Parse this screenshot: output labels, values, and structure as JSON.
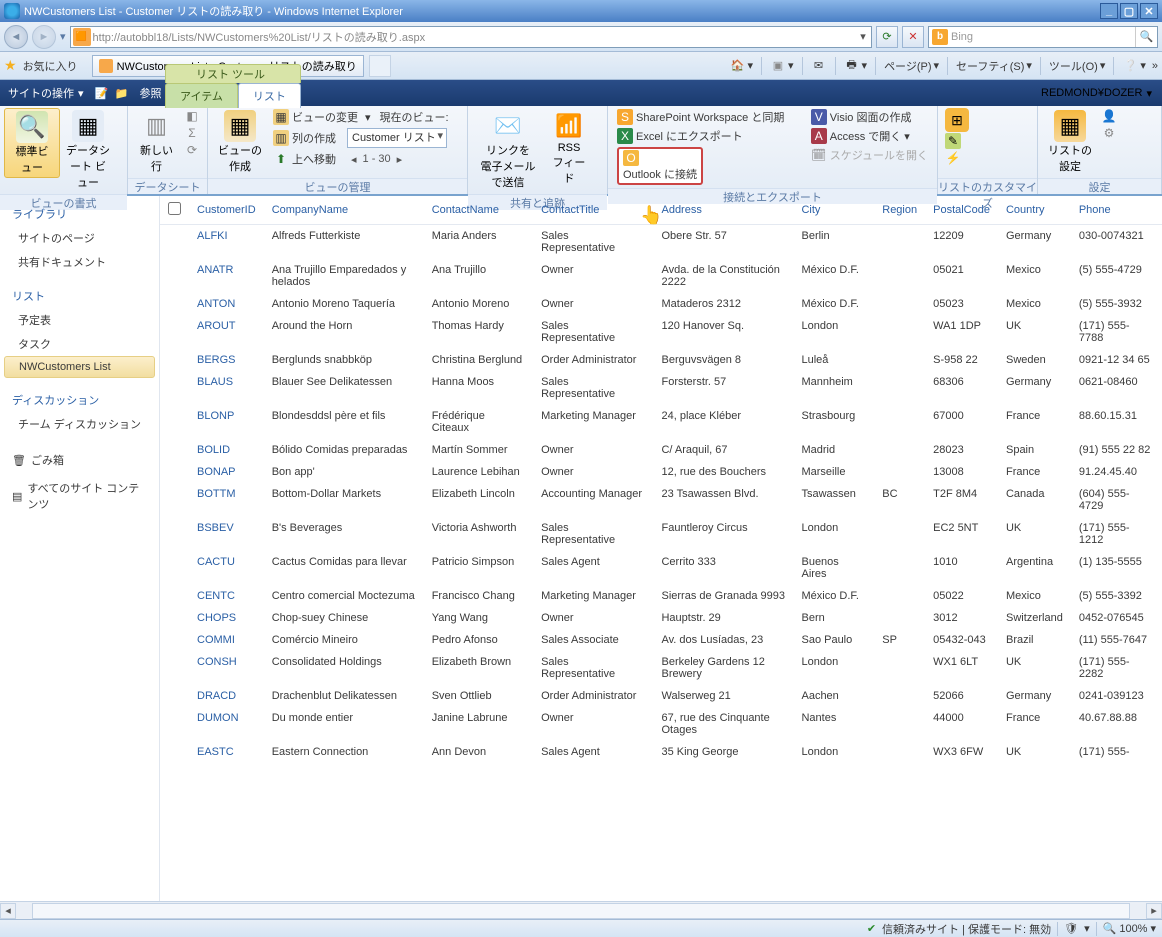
{
  "window": {
    "title": "NWCustomers List - Customer リストの読み取り - Windows Internet Explorer",
    "min": "_",
    "max": "▢",
    "close": "✕"
  },
  "nav": {
    "back": "◄",
    "forward": "►",
    "url": "http://autobbl18/Lists/NWCustomers%20List/リストの読み取り.aspx",
    "refresh": "⟳",
    "stop": "✕",
    "search_engine": "Bing",
    "bing_b": "b"
  },
  "favbar": {
    "favorites": "お気に入り",
    "tab_title": "NWCustomers List - Customer リストの読み取り",
    "page": "ページ(P)",
    "safety": "セーフティ(S)",
    "tools": "ツール(O)"
  },
  "sp": {
    "user": "REDMOND¥DOZER",
    "site_actions": "サイトの操作",
    "browse": "参照",
    "ctx_label": "リスト ツール",
    "tab_item": "アイテム",
    "tab_list": "リスト"
  },
  "ribbon": {
    "g_view_format": "ビューの書式",
    "standard_view": "標準ビュー",
    "datasheet_view": "データシート ビュー",
    "new_row": "新しい行",
    "g_datasheet": "データシート",
    "g_manage_views": "ビューの管理",
    "create_view": "ビューの作成",
    "modify_view": "ビューの変更",
    "current_view": "現在のビュー:",
    "create_column": "列の作成",
    "view_name": "Customer リスト",
    "navigate_up": "上へ移動",
    "paging": "1 - 30",
    "g_share": "共有と追跡",
    "email_link": "リンクを\n電子メールで送信",
    "rss": "RSS\nフィード",
    "g_connect": "接続とエクスポート",
    "sync_sp": "SharePoint Workspace と同期",
    "export_excel": "Excel にエクスポート",
    "outlook": "Outlook に接続",
    "visio": "Visio 図面の作成",
    "access": "Access で開く",
    "schedule": "スケジュールを開く",
    "g_customize": "リストのカスタマイズ",
    "g_settings": "設定",
    "list_settings": "リストの\n設定"
  },
  "ql": {
    "library": "ライブラリ",
    "site_pages": "サイトのページ",
    "shared_docs": "共有ドキュメント",
    "lists": "リスト",
    "calendar": "予定表",
    "tasks": "タスク",
    "nwcustomers": "NWCustomers List",
    "discussion": "ディスカッション",
    "team_disc": "チーム ディスカッション",
    "recycle": "ごみ箱",
    "all_content": "すべてのサイト コンテンツ"
  },
  "cols": {
    "CustomerID": "CustomerID",
    "CompanyName": "CompanyName",
    "ContactName": "ContactName",
    "ContactTitle": "ContactTitle",
    "Address": "Address",
    "City": "City",
    "Region": "Region",
    "PostalCode": "PostalCode",
    "Country": "Country",
    "Phone": "Phone"
  },
  "rows": [
    {
      "id": "ALFKI",
      "co": "Alfreds Futterkiste",
      "cn": "Maria Anders",
      "ct": "Sales Representative",
      "ad": "Obere Str. 57",
      "ci": "Berlin",
      "rg": "",
      "pc": "12209",
      "cy": "Germany",
      "ph": "030-0074321"
    },
    {
      "id": "ANATR",
      "co": "Ana Trujillo Emparedados y helados",
      "cn": "Ana Trujillo",
      "ct": "Owner",
      "ad": "Avda. de la Constitución 2222",
      "ci": "México D.F.",
      "rg": "",
      "pc": "05021",
      "cy": "Mexico",
      "ph": "(5) 555-4729"
    },
    {
      "id": "ANTON",
      "co": "Antonio Moreno Taquería",
      "cn": "Antonio Moreno",
      "ct": "Owner",
      "ad": "Mataderos 2312",
      "ci": "México D.F.",
      "rg": "",
      "pc": "05023",
      "cy": "Mexico",
      "ph": "(5) 555-3932"
    },
    {
      "id": "AROUT",
      "co": "Around the Horn",
      "cn": "Thomas Hardy",
      "ct": "Sales Representative",
      "ad": "120 Hanover Sq.",
      "ci": "London",
      "rg": "",
      "pc": "WA1 1DP",
      "cy": "UK",
      "ph": "(171) 555-7788"
    },
    {
      "id": "BERGS",
      "co": "Berglunds snabbköp",
      "cn": "Christina Berglund",
      "ct": "Order Administrator",
      "ad": "Berguvsvägen 8",
      "ci": "Luleå",
      "rg": "",
      "pc": "S-958 22",
      "cy": "Sweden",
      "ph": "0921-12 34 65"
    },
    {
      "id": "BLAUS",
      "co": "Blauer See Delikatessen",
      "cn": "Hanna Moos",
      "ct": "Sales Representative",
      "ad": "Forsterstr. 57",
      "ci": "Mannheim",
      "rg": "",
      "pc": "68306",
      "cy": "Germany",
      "ph": "0621-08460"
    },
    {
      "id": "BLONP",
      "co": "Blondesddsl père et fils",
      "cn": "Frédérique Citeaux",
      "ct": "Marketing Manager",
      "ad": "24, place Kléber",
      "ci": "Strasbourg",
      "rg": "",
      "pc": "67000",
      "cy": "France",
      "ph": "88.60.15.31"
    },
    {
      "id": "BOLID",
      "co": "Bólido Comidas preparadas",
      "cn": "Martín Sommer",
      "ct": "Owner",
      "ad": "C/ Araquil, 67",
      "ci": "Madrid",
      "rg": "",
      "pc": "28023",
      "cy": "Spain",
      "ph": "(91) 555 22 82"
    },
    {
      "id": "BONAP",
      "co": "Bon app'",
      "cn": "Laurence Lebihan",
      "ct": "Owner",
      "ad": "12, rue des Bouchers",
      "ci": "Marseille",
      "rg": "",
      "pc": "13008",
      "cy": "France",
      "ph": "91.24.45.40"
    },
    {
      "id": "BOTTM",
      "co": "Bottom-Dollar Markets",
      "cn": "Elizabeth Lincoln",
      "ct": "Accounting Manager",
      "ad": "23 Tsawassen Blvd.",
      "ci": "Tsawassen",
      "rg": "BC",
      "pc": "T2F 8M4",
      "cy": "Canada",
      "ph": "(604) 555-4729"
    },
    {
      "id": "BSBEV",
      "co": "B's Beverages",
      "cn": "Victoria Ashworth",
      "ct": "Sales Representative",
      "ad": "Fauntleroy Circus",
      "ci": "London",
      "rg": "",
      "pc": "EC2 5NT",
      "cy": "UK",
      "ph": "(171) 555-1212"
    },
    {
      "id": "CACTU",
      "co": "Cactus Comidas para llevar",
      "cn": "Patricio Simpson",
      "ct": "Sales Agent",
      "ad": "Cerrito 333",
      "ci": "Buenos Aires",
      "rg": "",
      "pc": "1010",
      "cy": "Argentina",
      "ph": "(1) 135-5555"
    },
    {
      "id": "CENTC",
      "co": "Centro comercial Moctezuma",
      "cn": "Francisco Chang",
      "ct": "Marketing Manager",
      "ad": "Sierras de Granada 9993",
      "ci": "México D.F.",
      "rg": "",
      "pc": "05022",
      "cy": "Mexico",
      "ph": "(5) 555-3392"
    },
    {
      "id": "CHOPS",
      "co": "Chop-suey Chinese",
      "cn": "Yang Wang",
      "ct": "Owner",
      "ad": "Hauptstr. 29",
      "ci": "Bern",
      "rg": "",
      "pc": "3012",
      "cy": "Switzerland",
      "ph": "0452-076545"
    },
    {
      "id": "COMMI",
      "co": "Comércio Mineiro",
      "cn": "Pedro Afonso",
      "ct": "Sales Associate",
      "ad": "Av. dos Lusíadas, 23",
      "ci": "Sao Paulo",
      "rg": "SP",
      "pc": "05432-043",
      "cy": "Brazil",
      "ph": "(11) 555-7647"
    },
    {
      "id": "CONSH",
      "co": "Consolidated Holdings",
      "cn": "Elizabeth Brown",
      "ct": "Sales Representative",
      "ad": "Berkeley Gardens 12 Brewery",
      "ci": "London",
      "rg": "",
      "pc": "WX1 6LT",
      "cy": "UK",
      "ph": "(171) 555-2282"
    },
    {
      "id": "DRACD",
      "co": "Drachenblut Delikatessen",
      "cn": "Sven Ottlieb",
      "ct": "Order Administrator",
      "ad": "Walserweg 21",
      "ci": "Aachen",
      "rg": "",
      "pc": "52066",
      "cy": "Germany",
      "ph": "0241-039123"
    },
    {
      "id": "DUMON",
      "co": "Du monde entier",
      "cn": "Janine Labrune",
      "ct": "Owner",
      "ad": "67, rue des Cinquante Otages",
      "ci": "Nantes",
      "rg": "",
      "pc": "44000",
      "cy": "France",
      "ph": "40.67.88.88"
    },
    {
      "id": "EASTC",
      "co": "Eastern Connection",
      "cn": "Ann Devon",
      "ct": "Sales Agent",
      "ad": "35 King George",
      "ci": "London",
      "rg": "",
      "pc": "WX3 6FW",
      "cy": "UK",
      "ph": "(171) 555-"
    }
  ],
  "status": {
    "trusted": "信頼済みサイト | 保護モード: 無効",
    "zoom": "100%"
  }
}
